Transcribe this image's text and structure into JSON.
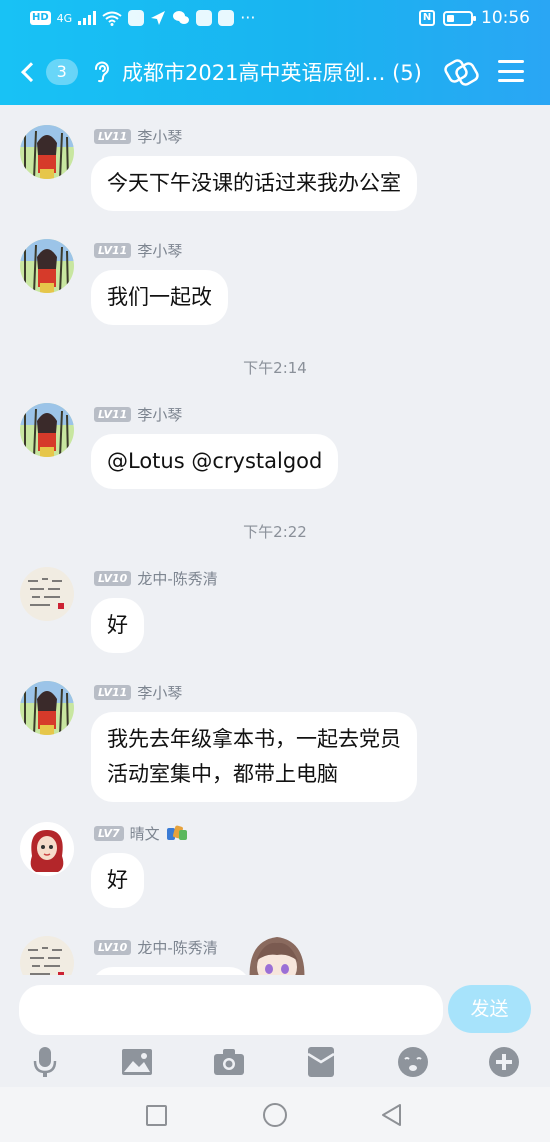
{
  "status_bar": {
    "hd": "HD",
    "signal": "4G",
    "time": "10:56",
    "nfc": "N",
    "more": "···"
  },
  "header": {
    "unread_count": "3",
    "title": "成都市2021高中英语原创… (5)"
  },
  "messages": [
    {
      "type": "msg",
      "level": "LV11",
      "nick": "李小琴",
      "lines": [
        "今天下午没课的话过来我办公室"
      ],
      "avatar": "girl-forest-avatar"
    },
    {
      "type": "msg",
      "level": "LV11",
      "nick": "李小琴",
      "lines": [
        "我们一起改"
      ],
      "avatar": "girl-forest-avatar"
    },
    {
      "type": "time",
      "text": "下午2:14"
    },
    {
      "type": "msg",
      "level": "LV11",
      "nick": "李小琴",
      "lines": [
        "@Lotus @crystalgod"
      ],
      "avatar": "girl-forest-avatar"
    },
    {
      "type": "time",
      "text": "下午2:22"
    },
    {
      "type": "msg",
      "level": "LV10",
      "nick": "龙中-陈秀清",
      "lines": [
        "好"
      ],
      "avatar": "calligraphy-avatar"
    },
    {
      "type": "msg",
      "level": "LV11",
      "nick": "李小琴",
      "lines": [
        "我先去年级拿本书，一起去党员",
        "活动室集中，都带上电脑"
      ],
      "avatar": "girl-forest-avatar"
    },
    {
      "type": "msg",
      "level": "LV7",
      "nick": "晴文",
      "lines": [
        "好"
      ],
      "avatar": "redhair-girl-avatar"
    },
    {
      "type": "msg",
      "level": "LV10",
      "nick": "龙中-陈秀清",
      "lines": [
        ""
      ],
      "avatar": "calligraphy-avatar"
    }
  ],
  "composer": {
    "placeholder": "",
    "send_label": "发送"
  },
  "toolbar": [
    "microphone-icon",
    "image-icon",
    "camera-icon",
    "red-packet-icon",
    "emoji-icon",
    "plus-icon"
  ],
  "colors": {
    "header_start": "#18c2f5",
    "header_end": "#2aa6f4",
    "background": "#eef0f4",
    "send_button": "#a7e3fb",
    "level_badge": "#b8bdc6"
  }
}
